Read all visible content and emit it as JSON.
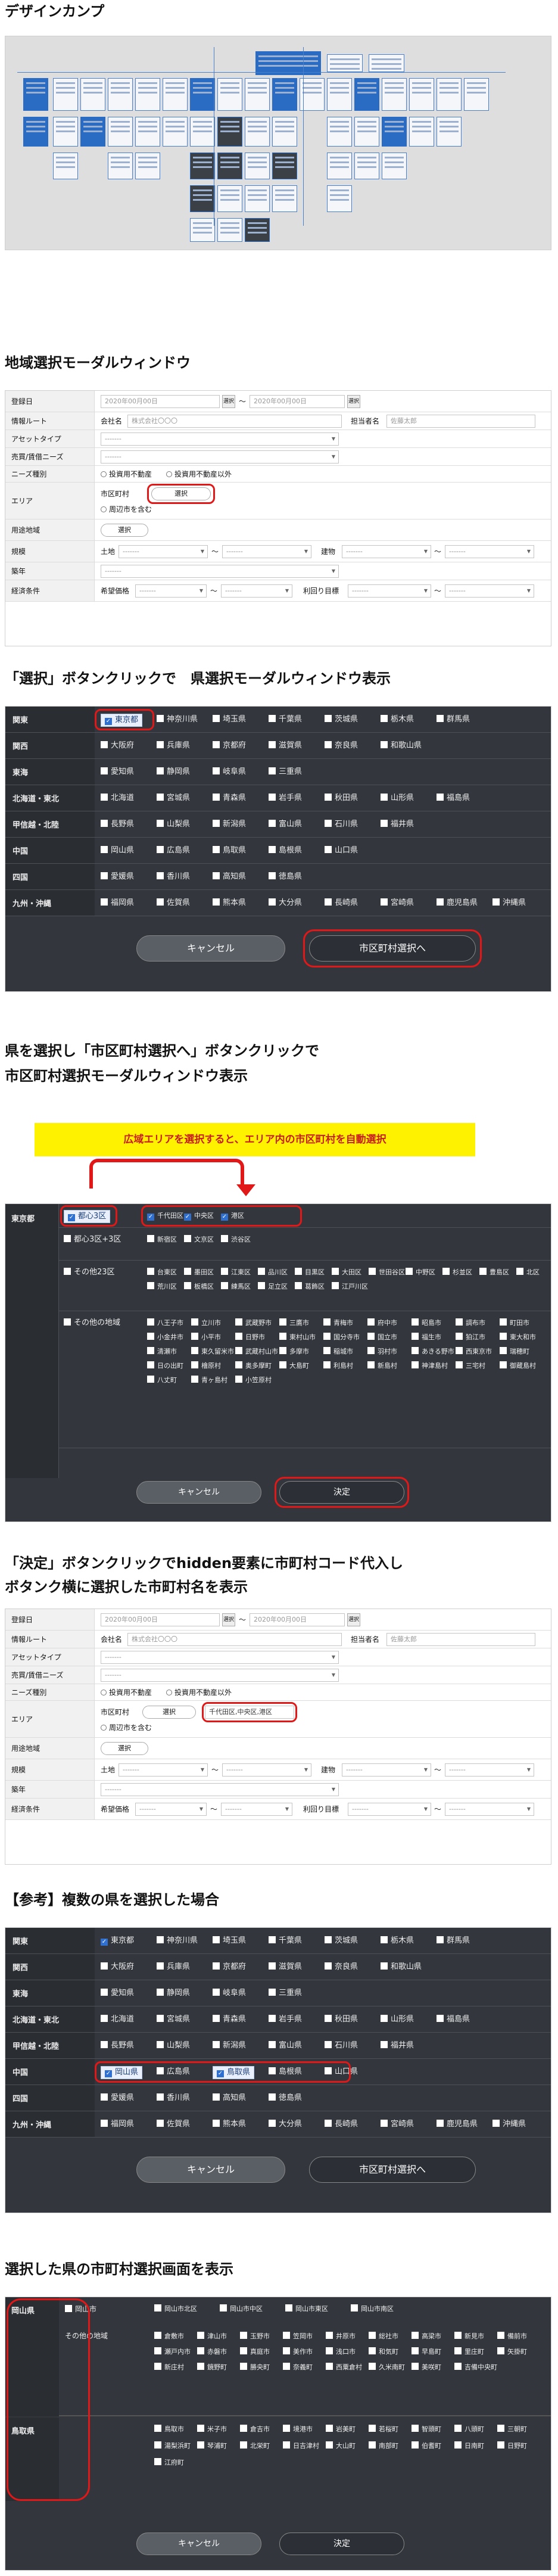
{
  "sections": {
    "s1": "デザインカンプ",
    "s2": "地域選択モーダルウィンドウ",
    "s3": "「選択」ボタンクリックで　県選択モーダルウィンドウ表示",
    "s4a": "県を選択し「市区町村選択へ」ボタンクリックで",
    "s4b": "市区町村選択モーダルウィンドウ表示",
    "s5a": "「決定」ボタンクリックでhidden要素に市町村コード代入し",
    "s5b": "ボタンク横に選択した市町村名を表示",
    "s6": "【参考】複数の県を選択した場合",
    "s7": "選択した県の市町村選択画面を表示"
  },
  "form": {
    "labels": [
      "登録日",
      "情報ルート",
      "アセットタイプ",
      "売買/賃借ニーズ",
      "ニーズ種別",
      "エリア",
      "用途地域",
      "規模",
      "築年",
      "経済条件"
    ],
    "date_from": "2020年00月00日",
    "date_to": "2020年00月00日",
    "cal": "選択",
    "tilde": "〜",
    "company_label": "会社名",
    "company_ph": "株式会社〇〇〇",
    "person_label": "担当者名",
    "person_ph": "佐藤太郎",
    "dash": "-------",
    "radio1": "投資用不動産",
    "radio2": "投資用不動産以外",
    "city_label": "市区町村",
    "select_btn": "選択",
    "nearby": "周辺市を含む",
    "land": "土地",
    "building": "建物",
    "hope_price": "希望価格",
    "yield": "利回り目標",
    "selected_cities": "千代田区,中央区,港区"
  },
  "pref_modal": {
    "rows": [
      {
        "region": "関東",
        "prefs": [
          "東京都",
          "神奈川県",
          "埼玉県",
          "千葉県",
          "茨城県",
          "栃木県",
          "群馬県"
        ]
      },
      {
        "region": "関西",
        "prefs": [
          "大阪府",
          "兵庫県",
          "京都府",
          "滋賀県",
          "奈良県",
          "和歌山県"
        ]
      },
      {
        "region": "東海",
        "prefs": [
          "愛知県",
          "静岡県",
          "岐阜県",
          "三重県"
        ]
      },
      {
        "region": "北海道・東北",
        "prefs": [
          "北海道",
          "宮城県",
          "青森県",
          "岩手県",
          "秋田県",
          "山形県",
          "福島県"
        ]
      },
      {
        "region": "甲信越・北陸",
        "prefs": [
          "長野県",
          "山梨県",
          "新潟県",
          "富山県",
          "石川県",
          "福井県"
        ]
      },
      {
        "region": "中国",
        "prefs": [
          "岡山県",
          "広島県",
          "鳥取県",
          "島根県",
          "山口県"
        ]
      },
      {
        "region": "四国",
        "prefs": [
          "愛媛県",
          "香川県",
          "高知県",
          "徳島県"
        ]
      },
      {
        "region": "九州・沖縄",
        "prefs": [
          "福岡県",
          "佐賀県",
          "熊本県",
          "大分県",
          "長崎県",
          "宮崎県",
          "鹿児島県",
          "沖縄県"
        ]
      }
    ],
    "cancel": "キャンセル",
    "next": "市区町村選択へ"
  },
  "city_modal": {
    "banner": "広域エリアを選択すると、エリア内の市区町村を自動選択",
    "pref": "東京都",
    "rows": [
      {
        "area": "都心3区",
        "cities": [
          "千代田区",
          "中央区",
          "港区"
        ]
      },
      {
        "area": "都心3区+3区",
        "cities": [
          "新宿区",
          "文京区",
          "渋谷区"
        ]
      },
      {
        "area": "その他23区",
        "cities": [
          "台東区",
          "墨田区",
          "江東区",
          "品川区",
          "目黒区",
          "大田区",
          "世田谷区",
          "中野区",
          "杉並区",
          "豊島区",
          "北区",
          "荒川区",
          "板橋区",
          "練馬区",
          "足立区",
          "葛飾区",
          "江戸川区"
        ]
      },
      {
        "area": "その他の地域",
        "cities": [
          "八王子市",
          "立川市",
          "武蔵野市",
          "三鷹市",
          "青梅市",
          "府中市",
          "昭島市",
          "調布市",
          "町田市",
          "小金井市",
          "小平市",
          "日野市",
          "東村山市",
          "国分寺市",
          "国立市",
          "福生市",
          "狛江市",
          "東大和市",
          "清瀬市",
          "東久留米市",
          "武蔵村山市",
          "多摩市",
          "稲城市",
          "羽村市",
          "あきる野市",
          "西東京市",
          "瑞穂町",
          "日の出町",
          "檜原村",
          "奥多摩町",
          "大島町",
          "利島村",
          "新島村",
          "神津島村",
          "三宅村",
          "御蔵島村",
          "八丈町",
          "青ヶ島村",
          "小笠原村"
        ]
      }
    ],
    "cancel": "キャンセル",
    "ok": "決定"
  },
  "multi_modal": {
    "okayama_label": "岡山県",
    "okayama_all": "岡山市",
    "okayama_wards": [
      "岡山市北区",
      "岡山市中区",
      "岡山市東区",
      "岡山市南区"
    ],
    "okayama_other_label": "その他の地域",
    "okayama_other": [
      "倉敷市",
      "津山市",
      "玉野市",
      "笠岡市",
      "井原市",
      "総社市",
      "高梁市",
      "新見市",
      "備前市",
      "瀬戸内市",
      "赤磐市",
      "真庭市",
      "美作市",
      "浅口市",
      "和気町",
      "早島町",
      "里庄町",
      "矢掛町",
      "新庄村",
      "鏡野町",
      "勝央町",
      "奈義町",
      "西粟倉村",
      "久米南町",
      "美咲町",
      "吉備中央町"
    ],
    "tottori_label": "鳥取県",
    "tottori": [
      "鳥取市",
      "米子市",
      "倉吉市",
      "境港市",
      "岩美町",
      "若桜町",
      "智頭町",
      "八頭町",
      "三朝町",
      "湯梨浜町",
      "琴浦町",
      "北栄町",
      "日吉津村",
      "大山町",
      "南部町",
      "伯耆町",
      "日南町",
      "日野町",
      "江府町"
    ],
    "cancel": "キャンセル",
    "ok": "決定"
  }
}
